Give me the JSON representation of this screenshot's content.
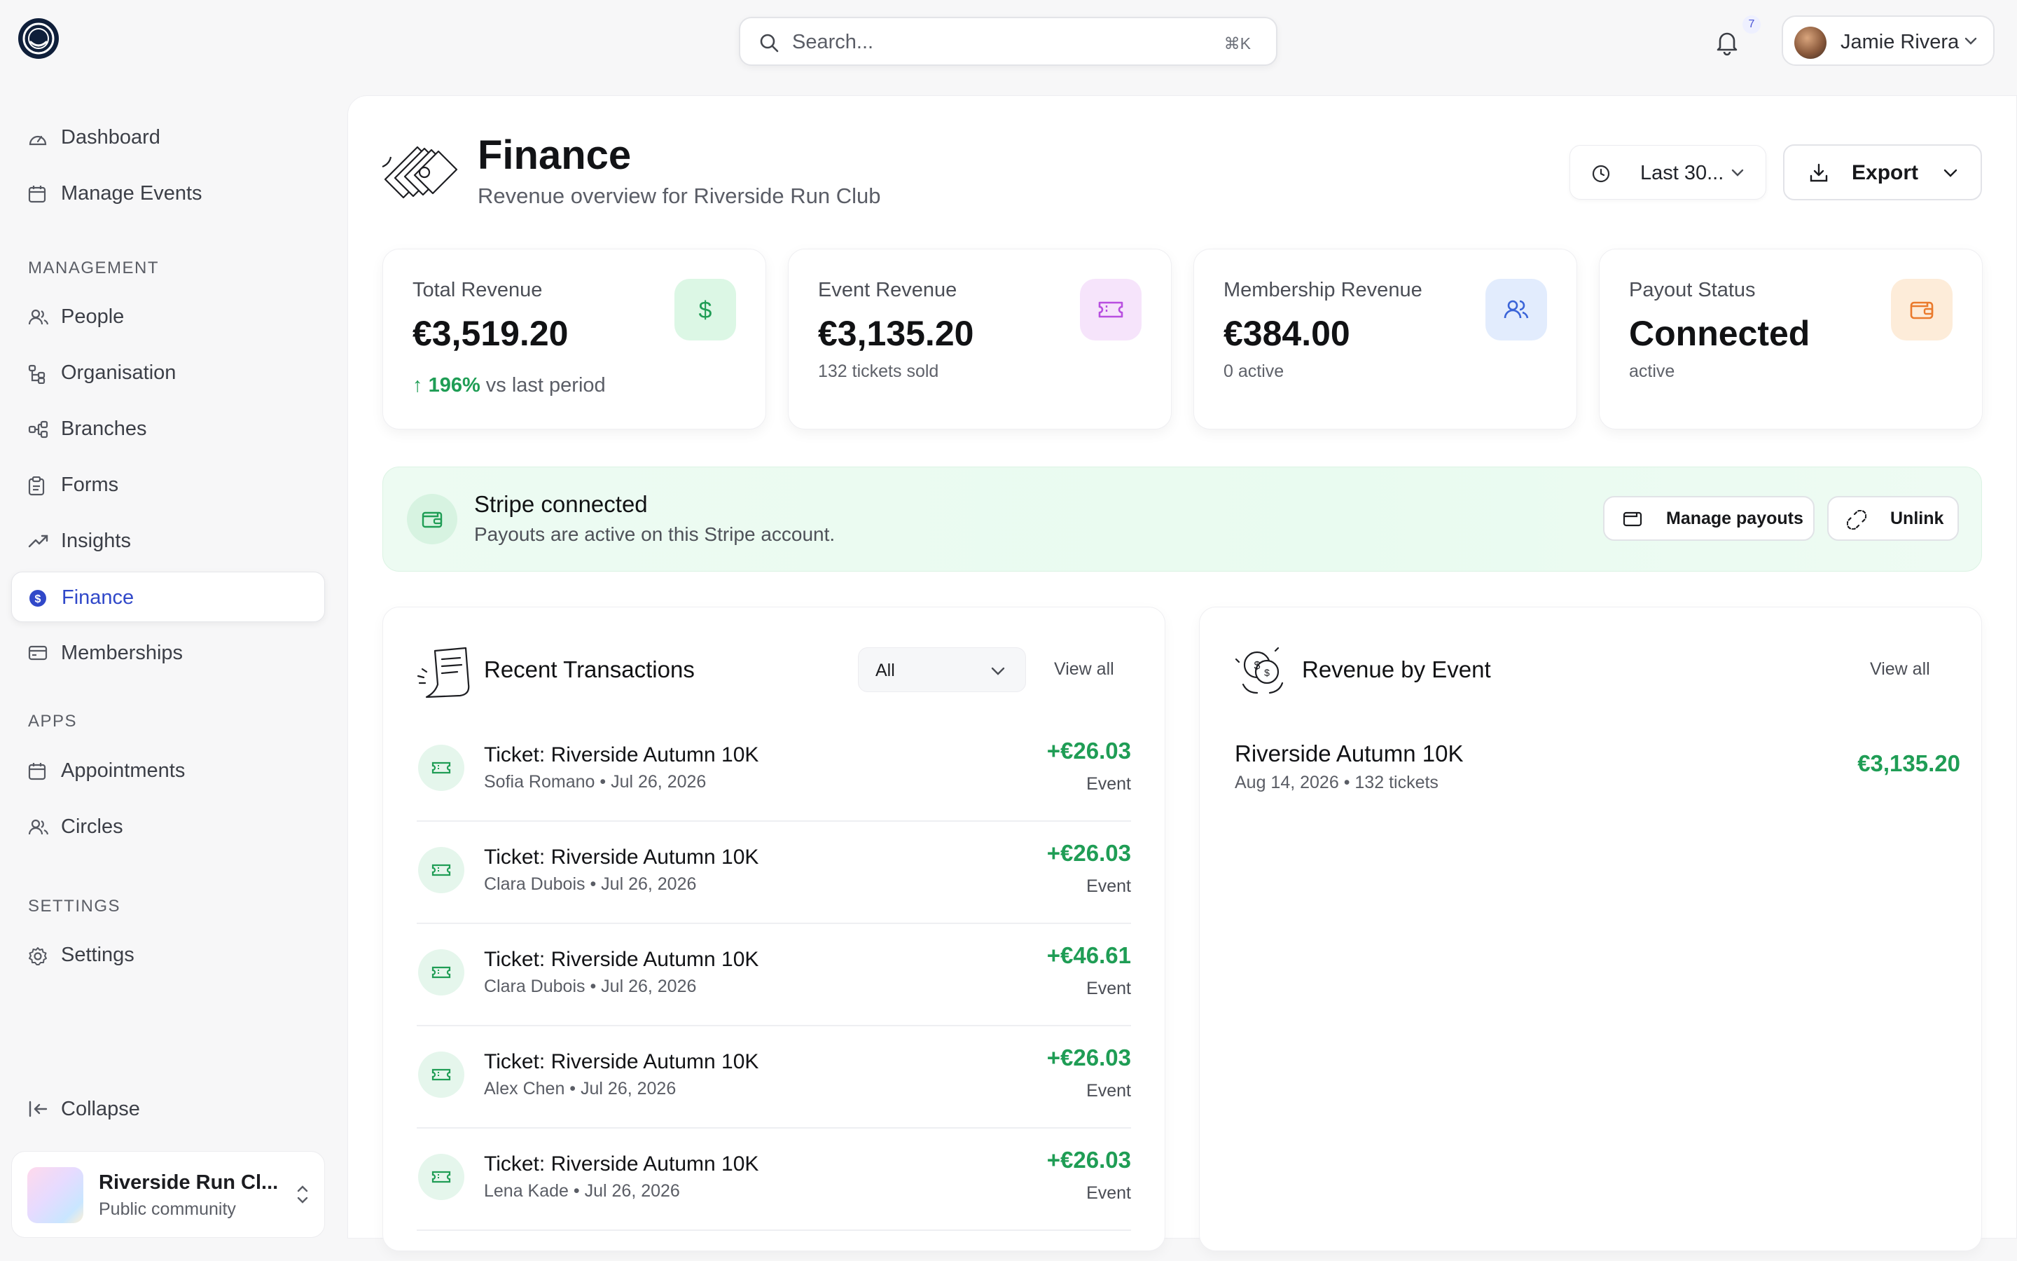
{
  "search": {
    "placeholder": "Search...",
    "shortcut": "⌘K"
  },
  "notifications": {
    "count": "7"
  },
  "user": {
    "name": "Jamie Rivera"
  },
  "sidebar": {
    "top_items": [
      {
        "label": "Dashboard",
        "icon": "gauge-icon"
      },
      {
        "label": "Manage Events",
        "icon": "calendar-icon"
      }
    ],
    "management_label": "MANAGEMENT",
    "management_items": [
      {
        "label": "People",
        "icon": "people-icon"
      },
      {
        "label": "Organisation",
        "icon": "org-tree-icon"
      },
      {
        "label": "Branches",
        "icon": "branches-icon"
      },
      {
        "label": "Forms",
        "icon": "clipboard-icon"
      },
      {
        "label": "Insights",
        "icon": "trend-icon"
      },
      {
        "label": "Finance",
        "icon": "dollar-circle-icon",
        "active": true
      },
      {
        "label": "Memberships",
        "icon": "card-icon"
      }
    ],
    "apps_label": "APPS",
    "apps_items": [
      {
        "label": "Appointments",
        "icon": "calendar-icon"
      },
      {
        "label": "Circles",
        "icon": "people-icon"
      }
    ],
    "settings_label": "SETTINGS",
    "settings_items": [
      {
        "label": "Settings",
        "icon": "gear-icon"
      }
    ],
    "collapse_label": "Collapse",
    "org": {
      "name": "Riverside Run Cl...",
      "visibility": "Public community"
    }
  },
  "header": {
    "title": "Finance",
    "subtitle": "Revenue overview for Riverside Run Club",
    "period_label": "Last 30...",
    "export_label": "Export"
  },
  "stats": [
    {
      "label": "Total Revenue",
      "value": "€3,519.20",
      "trend_pct": "196%",
      "trend_text": "vs last period",
      "icon": "dollar-icon",
      "icon_bg": "#dcf7e5",
      "icon_color": "#1f9d55"
    },
    {
      "label": "Event Revenue",
      "value": "€3,135.20",
      "sub": "132 tickets sold",
      "icon": "ticket-icon",
      "icon_bg": "#f6e4fb",
      "icon_color": "#b84fe0"
    },
    {
      "label": "Membership Revenue",
      "value": "€384.00",
      "sub": "0 active",
      "icon": "people-icon",
      "icon_bg": "#e2ecfd",
      "icon_color": "#3a64d8"
    },
    {
      "label": "Payout Status",
      "value": "Connected",
      "sub": "active",
      "icon": "wallet-icon",
      "icon_bg": "#fdecd9",
      "icon_color": "#ea7a2c"
    }
  ],
  "stripe": {
    "title": "Stripe connected",
    "subtitle": "Payouts are active on this Stripe account.",
    "manage_label": "Manage payouts",
    "unlink_label": "Unlink"
  },
  "transactions": {
    "title": "Recent Transactions",
    "filter_value": "All",
    "view_all": "View all",
    "rows": [
      {
        "title": "Ticket: Riverside Autumn 10K",
        "name": "Sofia Romano",
        "date": "Jul 26, 2026",
        "amount": "+€26.03",
        "type": "Event"
      },
      {
        "title": "Ticket: Riverside Autumn 10K",
        "name": "Clara Dubois",
        "date": "Jul 26, 2026",
        "amount": "+€26.03",
        "type": "Event"
      },
      {
        "title": "Ticket: Riverside Autumn 10K",
        "name": "Clara Dubois",
        "date": "Jul 26, 2026",
        "amount": "+€46.61",
        "type": "Event"
      },
      {
        "title": "Ticket: Riverside Autumn 10K",
        "name": "Alex Chen",
        "date": "Jul 26, 2026",
        "amount": "+€26.03",
        "type": "Event"
      },
      {
        "title": "Ticket: Riverside Autumn 10K",
        "name": "Lena Kade",
        "date": "Jul 26, 2026",
        "amount": "+€26.03",
        "type": "Event"
      }
    ]
  },
  "revenue_by_event": {
    "title": "Revenue by Event",
    "view_all": "View all",
    "rows": [
      {
        "title": "Riverside Autumn 10K",
        "date": "Aug 14, 2026",
        "tickets": "132 tickets",
        "amount": "€3,135.20"
      }
    ]
  },
  "colors": {
    "accent": "#3048c9",
    "positive": "#1f9d55",
    "background": "#f7f7f8"
  }
}
